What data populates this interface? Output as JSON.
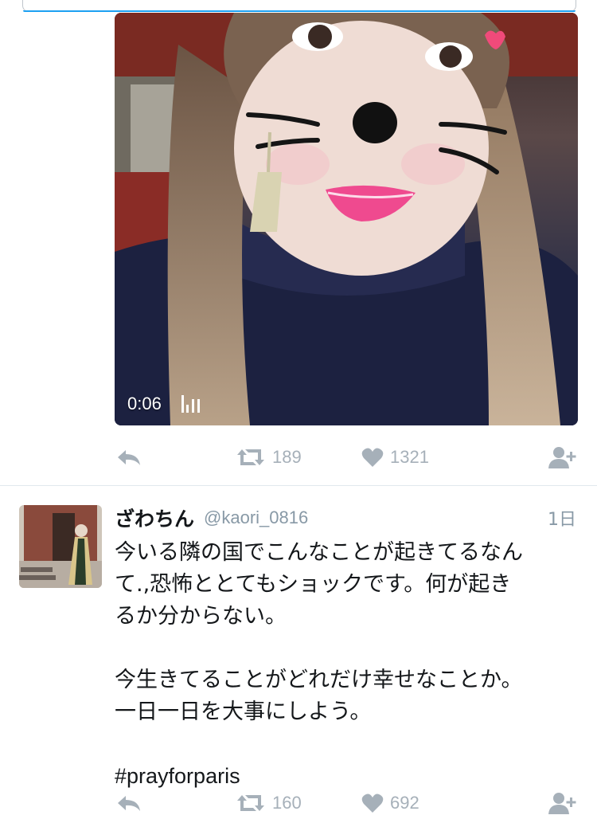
{
  "video": {
    "duration": "0:06"
  },
  "tweet1": {
    "retweets": "189",
    "likes": "1321"
  },
  "tweet2": {
    "display_name": "ざわちん",
    "handle": "@kaori_0816",
    "time": "1日",
    "lines1": [
      "今いる隣の国でこんなことが起きてるなん",
      "て.,恐怖ととてもショックです。何が起き",
      "るか分からない。"
    ],
    "lines2": [
      "今生きてることがどれだけ幸せなことか。",
      "一日一日を大事にしよう。"
    ],
    "hashtag": "#prayforparis",
    "retweets": "160",
    "likes": "692"
  },
  "icons": [
    "reply-icon",
    "retweet-icon",
    "like-icon",
    "follow-icon",
    "volume-bars-icon"
  ],
  "colors": {
    "action_gray": "#a6b0b9",
    "text_gray": "#8899a6",
    "accent_blue": "#1da1f2"
  }
}
